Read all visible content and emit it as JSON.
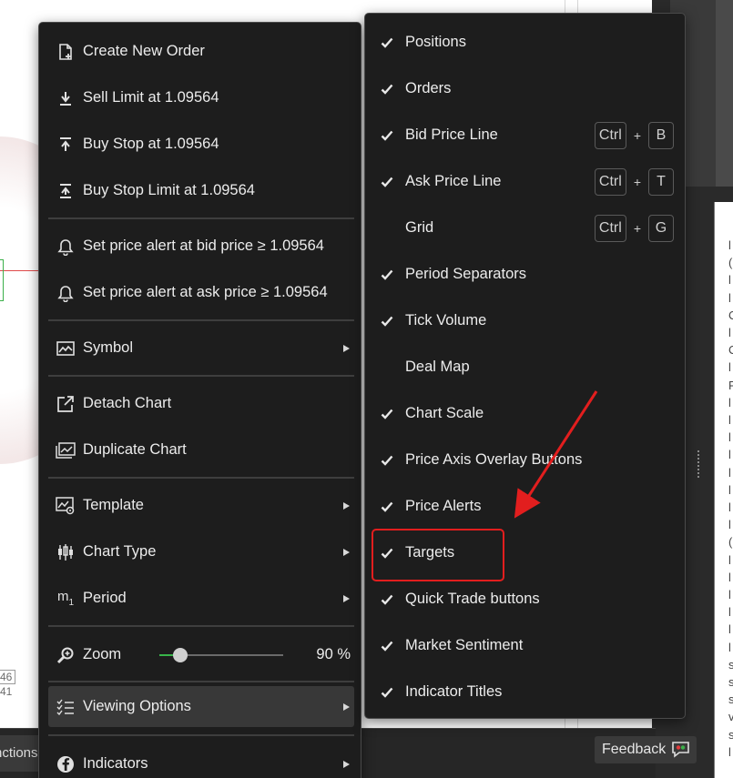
{
  "background": {
    "price_tick_1": "46",
    "price_tick_2": "41",
    "bottom_tab_label": "nctions",
    "feedback_label": "Feedback",
    "right_edge_letters": [
      "l",
      "(",
      "l",
      "l",
      "C",
      "l",
      "C",
      "l",
      "F",
      "l",
      "l",
      "l",
      "l",
      "l",
      "l",
      "l",
      "l",
      "(",
      "l",
      "l",
      "l",
      "l",
      "l",
      "l",
      "s",
      "s",
      "s",
      "v",
      "s",
      "l"
    ]
  },
  "context_menu": {
    "items": [
      {
        "label": "Create New Order",
        "icon": "new-order-icon"
      },
      {
        "label": "Sell Limit at 1.09564",
        "icon": "sell-limit-icon"
      },
      {
        "label": "Buy Stop at 1.09564",
        "icon": "buy-stop-icon"
      },
      {
        "label": "Buy Stop Limit at 1.09564",
        "icon": "buy-stop-limit-icon"
      },
      {
        "label": "Set price alert at bid price ≥ 1.09564",
        "icon": "bell-icon"
      },
      {
        "label": "Set price alert at ask price ≥ 1.09564",
        "icon": "bell-icon"
      },
      {
        "label": "Symbol",
        "icon": "symbol-chart-icon",
        "submenu": true
      },
      {
        "label": "Detach Chart",
        "icon": "detach-icon"
      },
      {
        "label": "Duplicate Chart",
        "icon": "duplicate-chart-icon"
      },
      {
        "label": "Template",
        "icon": "template-icon",
        "submenu": true
      },
      {
        "label": "Chart Type",
        "icon": "candlestick-icon",
        "submenu": true
      },
      {
        "label": "Period",
        "icon": "period-icon",
        "submenu": true
      },
      {
        "label": "Zoom",
        "icon": "zoom-icon",
        "value": "90 %",
        "zoom_fraction": 0.17
      },
      {
        "label": "Viewing Options",
        "icon": "viewing-options-icon",
        "submenu": true,
        "active": true
      },
      {
        "label": "Indicators",
        "icon": "indicators-icon",
        "submenu": true
      }
    ],
    "period_icon_text": {
      "main": "m",
      "sub": "1"
    }
  },
  "viewing_options": {
    "items": [
      {
        "label": "Positions",
        "checked": true
      },
      {
        "label": "Orders",
        "checked": true
      },
      {
        "label": "Bid Price Line",
        "checked": true,
        "shortcut": [
          "Ctrl",
          "B"
        ]
      },
      {
        "label": "Ask Price Line",
        "checked": true,
        "shortcut": [
          "Ctrl",
          "T"
        ]
      },
      {
        "label": "Grid",
        "checked": false,
        "shortcut": [
          "Ctrl",
          "G"
        ]
      },
      {
        "label": "Period Separators",
        "checked": true
      },
      {
        "label": "Tick Volume",
        "checked": true
      },
      {
        "label": "Deal Map",
        "checked": false
      },
      {
        "label": "Chart Scale",
        "checked": true
      },
      {
        "label": "Price Axis Overlay Buttons",
        "checked": true
      },
      {
        "label": "Price Alerts",
        "checked": true
      },
      {
        "label": "Targets",
        "checked": true,
        "highlighted": true
      },
      {
        "label": "Quick Trade buttons",
        "checked": true
      },
      {
        "label": "Market Sentiment",
        "checked": true
      },
      {
        "label": "Indicator Titles",
        "checked": true
      }
    ],
    "shortcut_plus": "+"
  },
  "colors": {
    "menu_bg": "#1d1d1d",
    "menu_text": "#ececec",
    "hover_bg": "#383838",
    "annotation_red": "#e21e1e",
    "slider_green": "#38b449"
  }
}
